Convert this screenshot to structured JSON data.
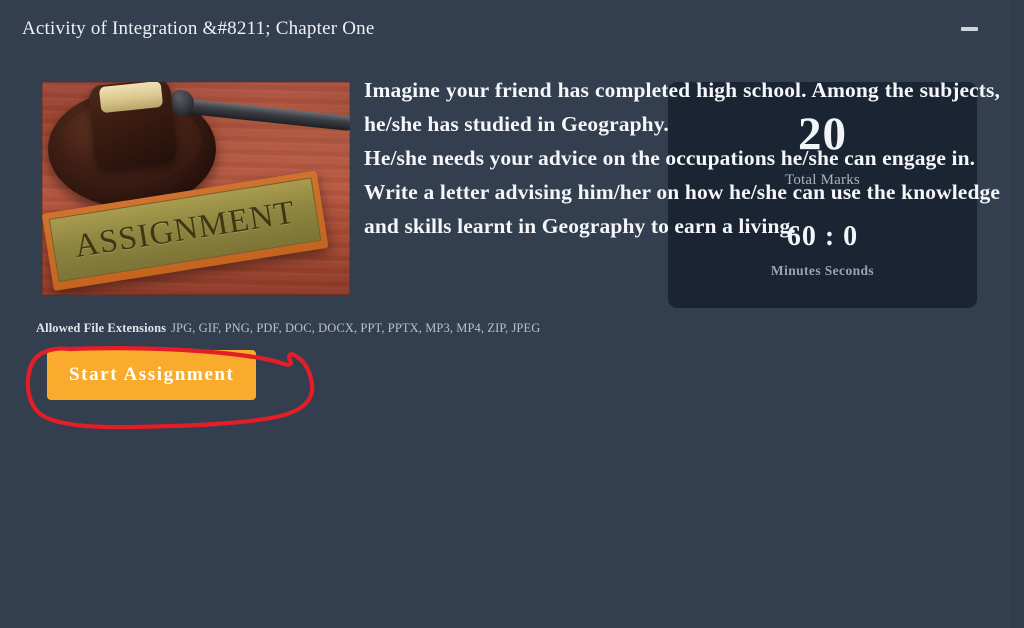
{
  "window": {
    "title": "Activity of Integration &#8211; Chapter One",
    "minimize_icon": "minimize-icon",
    "background_color": "#333f4f"
  },
  "assignment": {
    "image": {
      "alt": "Wooden gavel resting on desk beside a brass nameplate",
      "plate_text": "ASSIGNMENT",
      "icon": "gavel-icon"
    },
    "prompt_paragraphs": [
      "Imagine your friend has completed high school. Among the subjects, he/she has studied in Geography.",
      "He/she needs your advice on the occupations he/she can engage in.",
      "Write a letter advising him/her on how he/she can use the knowledge and skills learnt in Geography to earn a living."
    ],
    "extensions": {
      "label": "Allowed File Extensions",
      "list": "JPG, GIF, PNG, PDF, DOC, DOCX, PPT, PPTX, MP3, MP4, ZIP, JPEG"
    },
    "start_button": {
      "label": "Start Assignment",
      "color": "#f9ab2d",
      "text_color": "#ffffff"
    },
    "annotation": {
      "type": "hand-drawn-ellipse",
      "color": "#e41e26",
      "stroke_width": 4,
      "target": "start-assignment-button"
    }
  },
  "timer_panel": {
    "background_color": "#1b2432",
    "total_marks_value": "20",
    "total_marks_label": "Total Marks",
    "time_value": "60 : 0",
    "time_label": "Minutes Seconds"
  }
}
